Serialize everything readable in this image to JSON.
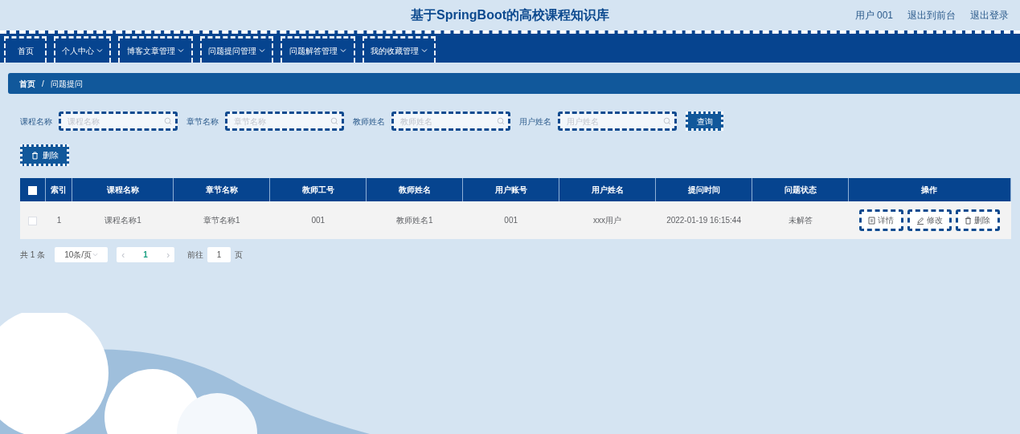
{
  "header": {
    "title": "基于SpringBoot的高校课程知识库",
    "links": [
      "用户 001",
      "退出到前台",
      "退出登录"
    ]
  },
  "nav": [
    {
      "label": "首页",
      "dropdown": false
    },
    {
      "label": "个人中心",
      "dropdown": true
    },
    {
      "label": "博客文章管理",
      "dropdown": true
    },
    {
      "label": "问题提问管理",
      "dropdown": true
    },
    {
      "label": "问题解答管理",
      "dropdown": true
    },
    {
      "label": "我的收藏管理",
      "dropdown": true
    }
  ],
  "breadcrumb": {
    "items": [
      "首页",
      "问题提问"
    ],
    "separator": "/"
  },
  "filters": [
    {
      "label": "课程名称",
      "placeholder": "课程名称"
    },
    {
      "label": "章节名称",
      "placeholder": "章节名称"
    },
    {
      "label": "教师姓名",
      "placeholder": "教师姓名"
    },
    {
      "label": "用户姓名",
      "placeholder": "用户姓名"
    }
  ],
  "search_button": "查询",
  "delete_button": "删除",
  "table": {
    "columns": [
      "索引",
      "课程名称",
      "章节名称",
      "教师工号",
      "教师姓名",
      "用户账号",
      "用户姓名",
      "提问时间",
      "问题状态",
      "操作"
    ],
    "header_checked": false,
    "rows": [
      {
        "checked": false,
        "cells": [
          "1",
          "课程名称1",
          "章节名称1",
          "001",
          "教师姓名1",
          "001",
          "xxx用户",
          "2022-01-19 16:15:44",
          "未解答"
        ],
        "actions": [
          {
            "kind": "detail",
            "label": "详情"
          },
          {
            "kind": "edit",
            "label": "修改"
          },
          {
            "kind": "delete",
            "label": "删除"
          }
        ]
      }
    ]
  },
  "pagination": {
    "total": "共 1 条",
    "page_size": "10条/页",
    "prev": "‹",
    "page": "1",
    "next": "›",
    "goto_label": "前往",
    "goto_value": "1",
    "goto_suffix": "页"
  }
}
